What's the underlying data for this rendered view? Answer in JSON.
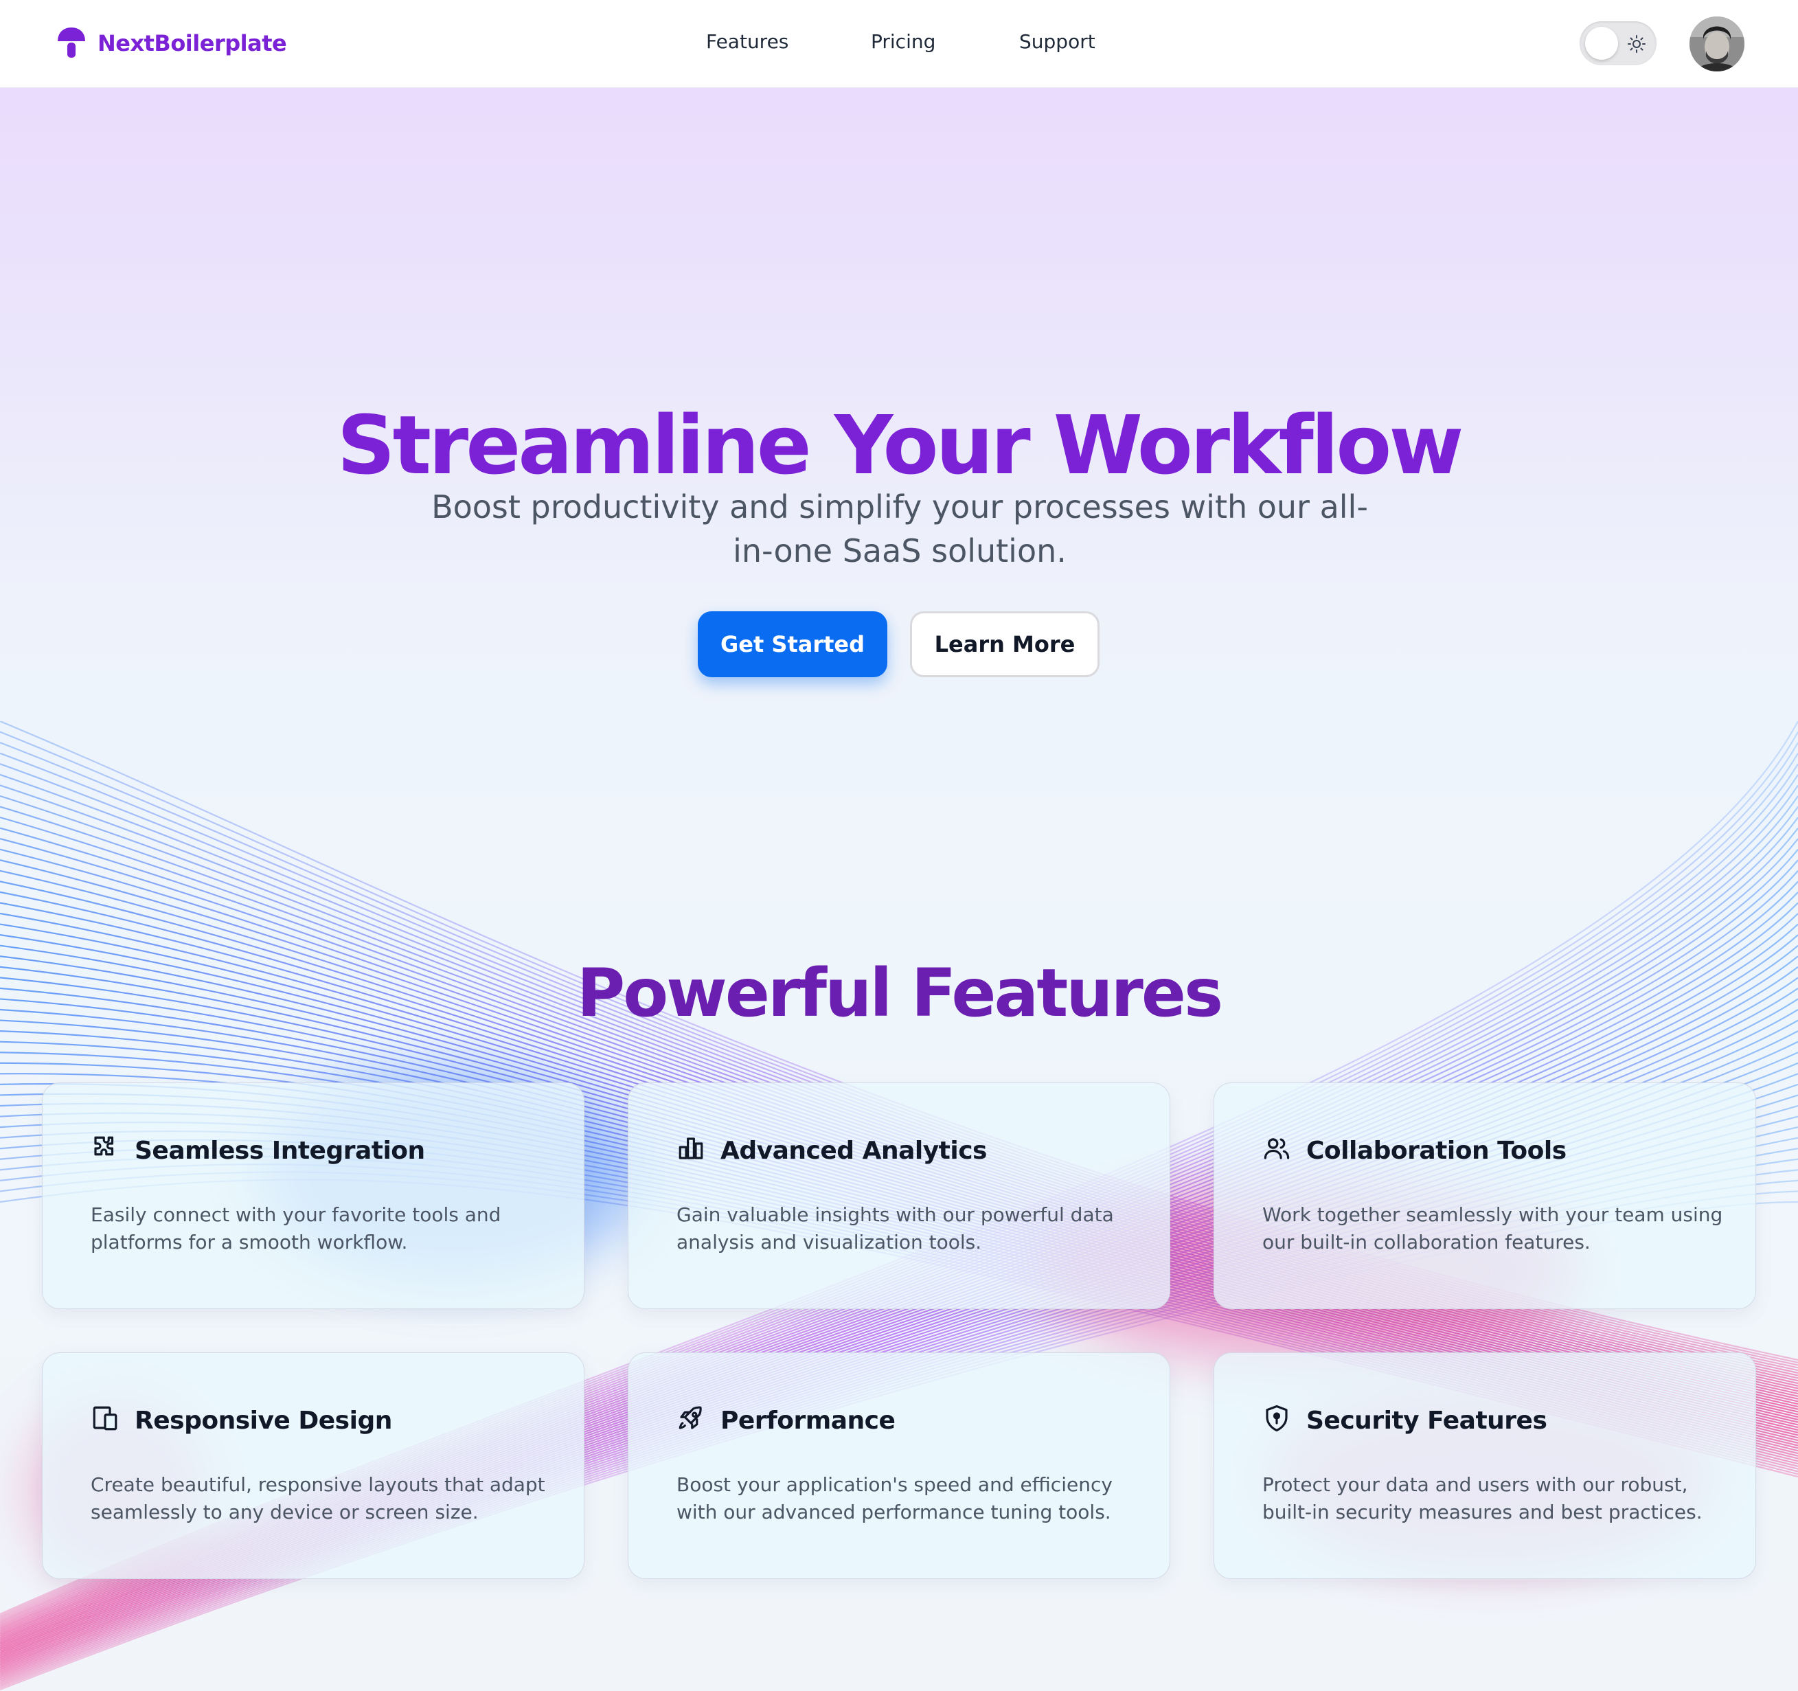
{
  "navbar": {
    "brand_name": "NextBoilerplate",
    "links": [
      {
        "label": "Features"
      },
      {
        "label": "Pricing"
      },
      {
        "label": "Support"
      }
    ],
    "theme_toggle_icon": "sun-icon"
  },
  "hero": {
    "title": "Streamline Your Workflow",
    "subtitle": "Boost productivity and simplify your processes with our all-in-one SaaS solution.",
    "primary_button": "Get Started",
    "secondary_button": "Learn More"
  },
  "features": {
    "title": "Powerful Features",
    "items": [
      {
        "icon": "puzzle-icon",
        "title": "Seamless Integration",
        "description": "Easily connect with your favorite tools and platforms for a smooth workflow."
      },
      {
        "icon": "bar-chart-icon",
        "title": "Advanced Analytics",
        "description": "Gain valuable insights with our powerful data analysis and visualization tools."
      },
      {
        "icon": "users-icon",
        "title": "Collaboration Tools",
        "description": "Work together seamlessly with your team using our built-in collaboration features."
      },
      {
        "icon": "devices-icon",
        "title": "Responsive Design",
        "description": "Create beautiful, responsive layouts that adapt seamlessly to any device or screen size."
      },
      {
        "icon": "rocket-icon",
        "title": "Performance",
        "description": "Boost your application's speed and efficiency with our advanced performance tuning tools."
      },
      {
        "icon": "shield-icon",
        "title": "Security Features",
        "description": "Protect your data and users with our robust, built-in security measures and best practices."
      }
    ]
  },
  "colors": {
    "brand": "#7c22d6",
    "primary_button": "#0a6cf0",
    "section_title": "#6a1fb0",
    "wave_blue": "#3b82f6",
    "wave_pink": "#ec4899"
  }
}
